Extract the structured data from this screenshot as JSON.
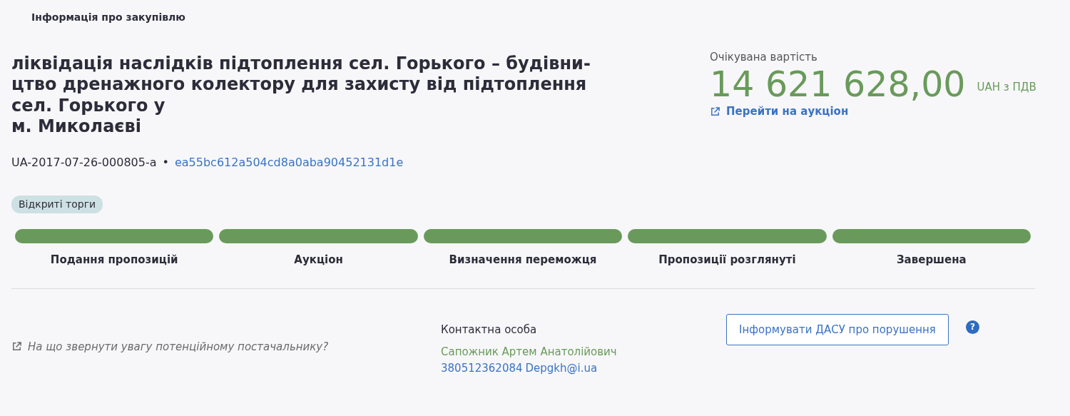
{
  "section_title": "Інформація про закупівлю",
  "tender": {
    "title_lines": [
      "ліквідація наслідків підтоплення сел. Горького – будівни-",
      "цтво дренажного колектору для захисту від підтоплення",
      "сел. Горького у",
      "м. Миколаєві"
    ],
    "tender_id": "UA-2017-07-26-000805-a",
    "separator": "•",
    "hash_link": "ea55bc612a504cd8a0aba90452131d1e",
    "procedure_badge": "Відкриті торги"
  },
  "price": {
    "label": "Очікувана вартість",
    "amount": "14 621 628,00",
    "currency": "UAH з ПДВ",
    "auction_link": "Перейти на аукціон"
  },
  "stages": [
    {
      "label": "Подання пропозицій",
      "completed": true
    },
    {
      "label": "Аукціон",
      "completed": true
    },
    {
      "label": "Визначення переможця",
      "completed": true
    },
    {
      "label": "Пропозиції розглянуті",
      "completed": true
    },
    {
      "label": "Завершена",
      "completed": true
    }
  ],
  "footer": {
    "supplier_hint": "На що звернути увагу потенційному постачальнику?",
    "contact_heading": "Контактна особа",
    "contact_name": "Сапожник Артем Анатолійович",
    "contact_phone": "380512362084",
    "contact_email": "Depgkh@i.ua",
    "report_button": "Інформувати ДАСУ про порушення",
    "help": "?"
  }
}
